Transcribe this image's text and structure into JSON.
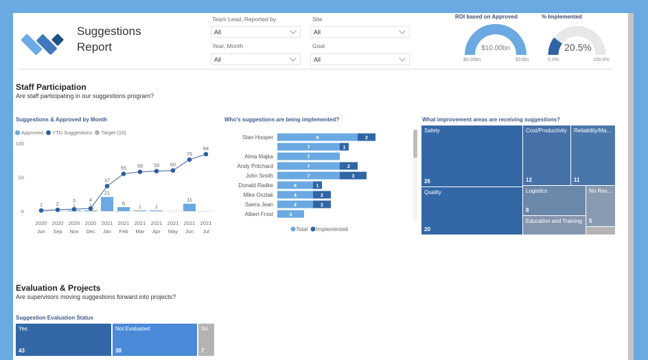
{
  "header": {
    "title_line1": "Suggestions",
    "title_line2": "Report",
    "logo_colors": [
      "#6aaae6",
      "#3f78bd",
      "#1f4f85"
    ]
  },
  "filters": [
    {
      "label": "Team Lead, Reported by",
      "value": "All"
    },
    {
      "label": "Site",
      "value": "All"
    },
    {
      "label": "Year, Month",
      "value": "All"
    },
    {
      "label": "Goal",
      "value": "All"
    }
  ],
  "gauges": [
    {
      "title": "ROI based on Approved",
      "value": 10,
      "min": 0,
      "max": 10,
      "value_label": "$10.00bn",
      "min_label": "$0.00bn",
      "max_label": "$10bn",
      "color": "#6aa9e2",
      "track_color": "#e8e8e8"
    },
    {
      "title": "% Implemented",
      "value": 20.5,
      "min": 0,
      "max": 100,
      "value_label": "20.5%",
      "min_label": "0.0%",
      "max_label": "100.0%",
      "color": "#2f65a5",
      "track_color": "#e8e8e8"
    }
  ],
  "staff_section": {
    "title": "Staff Participation",
    "subtitle": "Are staff participating in our suggestions program?"
  },
  "eval_section": {
    "title": "Evaluation & Projects",
    "subtitle": "Are supervisors moving suggestions forward into projects?"
  },
  "chart_data": [
    {
      "type": "bar+line",
      "title": "Suggestions & Approved by Month",
      "legend_position": "top-left",
      "legend": [
        {
          "label": "Approved",
          "color": "#6aa9e2"
        },
        {
          "label": "YTD Suggestions",
          "color": "#2f5e9e"
        },
        {
          "label": "Target (10)",
          "color": "#b0b0b0"
        }
      ],
      "categories": [
        {
          "year": "2020",
          "month": "Jun"
        },
        {
          "year": "2020",
          "month": "Sep"
        },
        {
          "year": "2020",
          "month": "Nov"
        },
        {
          "year": "2020",
          "month": "Dec"
        },
        {
          "year": "2021",
          "month": "Jan"
        },
        {
          "year": "2021",
          "month": "Feb"
        },
        {
          "year": "2021",
          "month": "Mar"
        },
        {
          "year": "2021",
          "month": "Apr"
        },
        {
          "year": "2021",
          "month": "May"
        },
        {
          "year": "2021",
          "month": "Jun"
        },
        {
          "year": "2021",
          "month": "Jul"
        }
      ],
      "series": [
        {
          "name": "Approved",
          "type": "bar",
          "color": "#6aa9e2",
          "values": [
            null,
            null,
            1,
            1,
            21,
            6,
            1,
            1,
            null,
            11,
            null
          ]
        },
        {
          "name": "YTD Suggestions",
          "type": "line",
          "color": "#2f5e9e",
          "line_color": "#5479b0",
          "values": [
            1,
            2,
            3,
            4,
            37,
            55,
            58,
            59,
            60,
            76,
            84
          ]
        },
        {
          "name": "Target (10)",
          "type": "line",
          "style": "dotted",
          "color": "#b0b0b0"
        }
      ],
      "yticks": [
        0,
        50,
        100
      ],
      "ylim": [
        0,
        100
      ],
      "xlabel": "",
      "ylabel": "",
      "grid": false
    },
    {
      "type": "bar",
      "orientation": "horizontal",
      "stacked": true,
      "title": "Who's suggestions are being implemented?",
      "legend_position": "bottom-center",
      "categories": [
        "Stan Hooper",
        "",
        "Alma Majka",
        "Andy Pritchard",
        "John Smith",
        "Donald Radke",
        "Mike Oszlak",
        "Saera Jean",
        "Albert Frost"
      ],
      "series": [
        {
          "name": "Total",
          "color": "#6aa9e2",
          "values": [
            9,
            7,
            7,
            7,
            7,
            4,
            4,
            4,
            3
          ]
        },
        {
          "name": "Implemented",
          "color": "#2f65a5",
          "values": [
            2,
            1,
            null,
            2,
            3,
            1,
            2,
            2,
            null
          ]
        }
      ],
      "scrollbar": {
        "visible": true
      }
    },
    {
      "type": "treemap",
      "title": "What improvement areas are receiving suggestions?",
      "items": [
        {
          "label": "Safety",
          "value": 26,
          "color": "#3467a6"
        },
        {
          "label": "Quality",
          "value": 20,
          "color": "#3467a6"
        },
        {
          "label": "Cost/Productivity",
          "value": 12,
          "color": "#4571a8"
        },
        {
          "label": "Reliability/Ma...",
          "value": 11,
          "color": "#4a77aa"
        },
        {
          "label": "Logistics",
          "value": 8,
          "color": "#6a88a9"
        },
        {
          "label": "Education and Training",
          "value": null,
          "color": "#8496ae"
        },
        {
          "label": "No Res...",
          "value": 5,
          "color": "#8a9bb1"
        },
        {
          "label": "",
          "value": null,
          "color": "#b4b4b4"
        }
      ]
    },
    {
      "type": "treemap",
      "title": "Suggestion Evaluation Status",
      "items": [
        {
          "label": "Yes",
          "value": 43,
          "color": "#3467a6"
        },
        {
          "label": "Not Evaluated",
          "value": 38,
          "color": "#4a8ad8"
        },
        {
          "label": "No",
          "value": 7,
          "color": "#b3b3b3"
        }
      ]
    }
  ]
}
